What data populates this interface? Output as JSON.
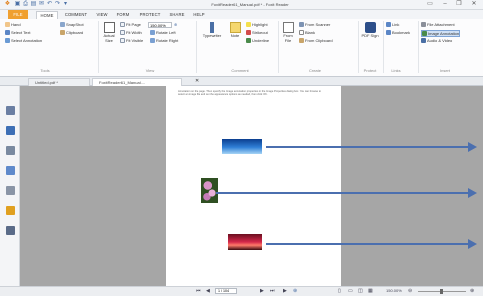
{
  "window": {
    "title": "FoxitReader61_Manual.pdf * - Foxit Reader",
    "controls": [
      "minimize-icon",
      "restore-icon",
      "close-icon"
    ]
  },
  "ribbon_tabs": [
    "FILE",
    "HOME",
    "COMMENT",
    "VIEW",
    "FORM",
    "PROTECT",
    "SHARE",
    "HELP"
  ],
  "find": {
    "placeholder": "Find"
  },
  "ribbon": {
    "tools": {
      "hand_label": "Hand",
      "select_text_label": "Select Text",
      "select_annotation_label": "Select Annotation",
      "snapshot_label": "SnapShot",
      "clipboard_label": "Clipboard",
      "group_label": "Tools"
    },
    "view": {
      "actual_size_label": "Actual Size",
      "fit_page_label": "Fit Page",
      "fit_width_label": "Fit Width",
      "fit_visible_label": "Fit Visible",
      "zoom_value": "150.00%",
      "rotate_left_label": "Rotate Left",
      "rotate_right_label": "Rotate Right",
      "group_label": "View"
    },
    "comment": {
      "typewriter_label": "Typewriter",
      "note_label": "Note",
      "highlight_label": "Highlight",
      "strikeout_label": "Strikeout",
      "underline_label": "Underline",
      "group_label": "Comment"
    },
    "create": {
      "from_file_label": "From File",
      "from_scanner_label": "From Scanner",
      "blank_label": "Blank",
      "from_clipboard_label": "From Clipboard",
      "group_label": "Create"
    },
    "protect": {
      "pdf_sign_label": "PDF Sign",
      "group_label": "Protect"
    },
    "links": {
      "link_label": "Link",
      "bookmark_label": "Bookmark",
      "group_label": "Links"
    },
    "insert": {
      "file_attachment_label": "File Attachment",
      "image_annotation_label": "Image Annotation",
      "audio_video_label": "Audio & Video",
      "group_label": "Insert"
    }
  },
  "doc_tabs": [
    {
      "label": "Untitled.pdf *",
      "active": false
    },
    {
      "label": "FoxitReader61_Manual....",
      "active": true
    }
  ],
  "page": {
    "body_text": "Annotation on the page. Then specify the Image annotation properties in the Image Properties dialog box. You can browse to select an image file and set the appearance options as needed, then click OK."
  },
  "status": {
    "page_value": "1 / 104",
    "zoom_value": "150.00%"
  },
  "colors": {
    "file_tab": "#f0a030",
    "accent": "#4b6faf",
    "workspace": "#a6a6a6"
  }
}
